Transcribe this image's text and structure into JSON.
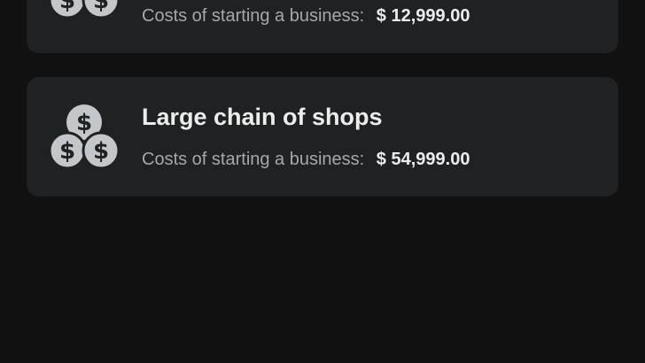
{
  "businesses": [
    {
      "title": "",
      "cost_label": "Costs of starting a business:",
      "cost_value": "$ 12,999.00",
      "icon": "coins-stack-icon"
    },
    {
      "title": "Large chain of shops",
      "cost_label": "Costs of starting a business:",
      "cost_value": "$ 54,999.00",
      "icon": "coins-stack-icon"
    }
  ],
  "colors": {
    "background": "#111111",
    "card": "#1f2123",
    "icon": "#c4c7ca",
    "label": "#a5a8ab",
    "value": "#ececec"
  }
}
